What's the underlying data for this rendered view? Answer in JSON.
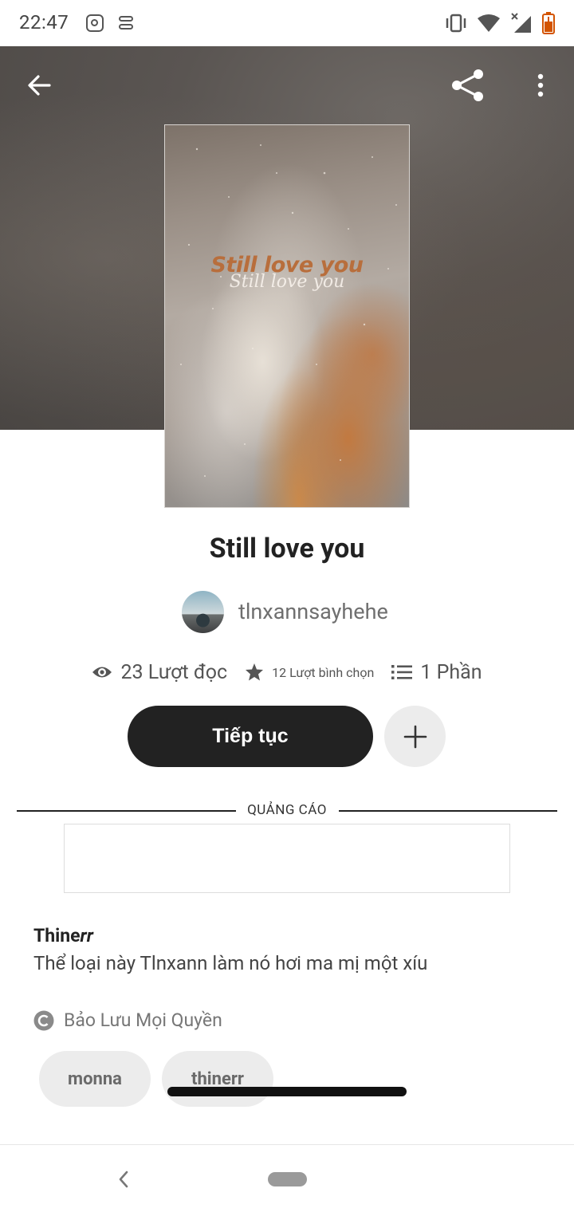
{
  "status_bar": {
    "time": "22:47",
    "icons": [
      "instagram-icon",
      "toggle-icon",
      "vibrate-icon",
      "wifi-icon",
      "signal-icon",
      "battery-icon"
    ]
  },
  "top_bar": {
    "icons": [
      "back-arrow-icon",
      "share-icon",
      "more-vert-icon"
    ]
  },
  "cover": {
    "title": "Still love you",
    "subtitle": "Still love you"
  },
  "story": {
    "title": "Still love you",
    "author": "tlnxannsayhehe"
  },
  "stats": {
    "reads": "23 Lượt đọc",
    "votes": "12 Lượt bình chọn",
    "parts": "1 Phần"
  },
  "actions": {
    "continue_label": "Tiếp tục"
  },
  "ad": {
    "label": "QUẢNG CÁO"
  },
  "description": {
    "title_prefix": "Thine",
    "title_suffix": "rr",
    "text": "Thể loại này Tlnxann làm nó hơi ma mị một xíu"
  },
  "copyright": {
    "text": "Bảo Lưu Mọi Quyền"
  },
  "tags": [
    "monna",
    "thinerr"
  ],
  "colors": {
    "primary_button": "#222222",
    "secondary_button": "#ececec",
    "hero_background": "#5a5552"
  }
}
